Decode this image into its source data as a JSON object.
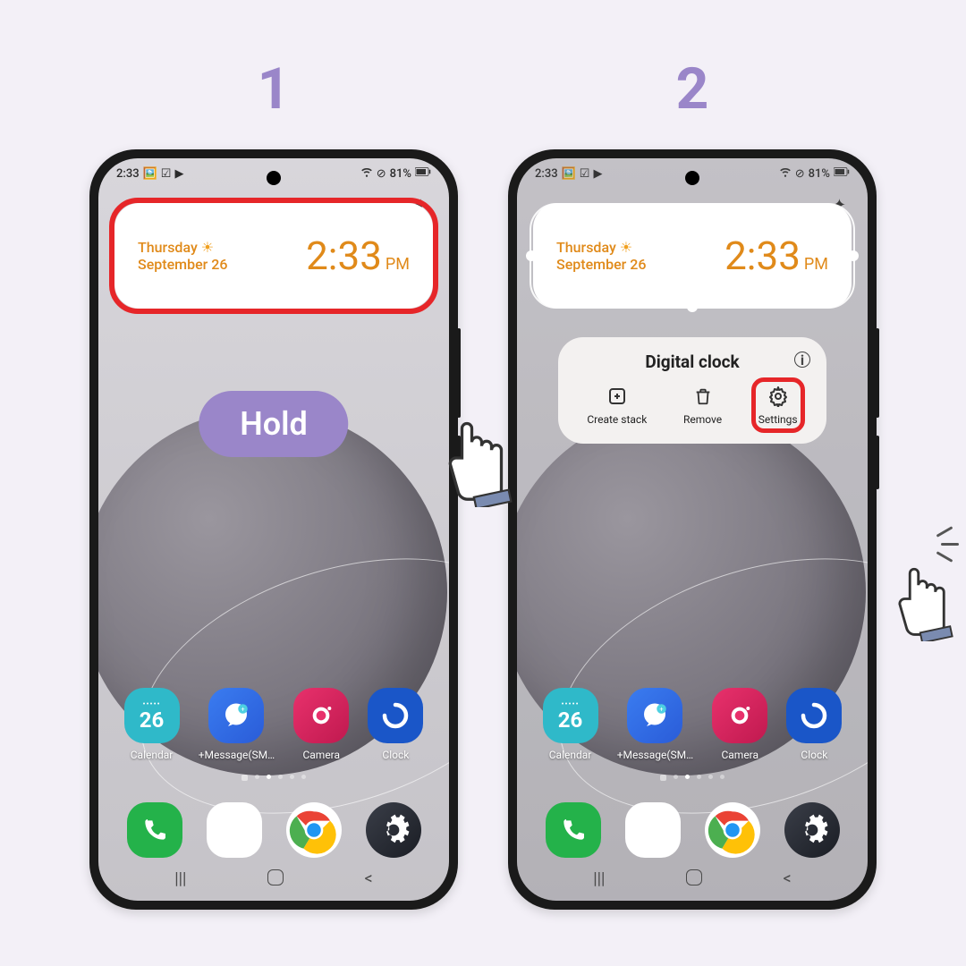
{
  "steps": {
    "one": "1",
    "two": "2"
  },
  "status": {
    "time": "2:33",
    "battery": "81%"
  },
  "widget": {
    "day": "Thursday",
    "date": "September 26",
    "clock": "2:33",
    "ampm": "PM",
    "calendar_day": "26"
  },
  "hold_label": "Hold",
  "popup": {
    "title": "Digital clock",
    "create_stack": "Create stack",
    "remove": "Remove",
    "settings": "Settings"
  },
  "apps": {
    "calendar": "Calendar",
    "message": "+Message(SM…",
    "camera": "Camera",
    "clock": "Clock"
  }
}
